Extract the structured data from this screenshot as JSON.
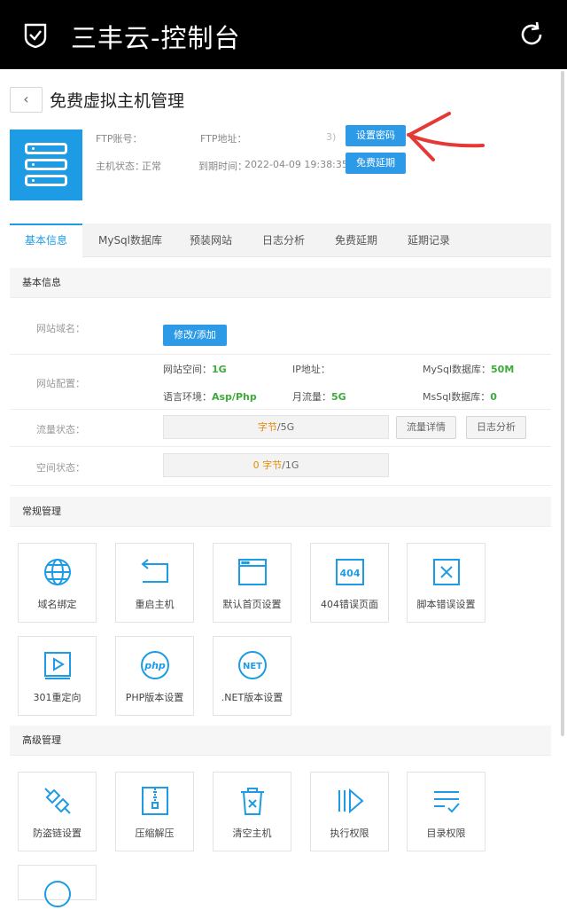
{
  "app_title": "三丰云-控制台",
  "page_title": "免费虚拟主机管理",
  "back_label": "‹",
  "host_info": {
    "ftp_account_label": "FTP账号：",
    "ftp_address_label": "FTP地址：",
    "host_status_label": "主机状态：",
    "host_status_value": "正常",
    "expire_label": "到期时间：",
    "expire_value": "2022-04-09 19:38:35",
    "bracket_fragment": "3)"
  },
  "buttons": {
    "set_password": "设置密码",
    "free_extend": "免费延期",
    "modify_add": "修改/添加",
    "traffic_detail": "流量详情",
    "log_analysis": "日志分析"
  },
  "tabs": [
    "基本信息",
    "MySql数据库",
    "预装网站",
    "日志分析",
    "免费延期",
    "延期记录"
  ],
  "basic_info": {
    "heading": "基本信息",
    "domain_label": "网站域名：",
    "config_label": "网站配置：",
    "traffic_label": "流量状态：",
    "space_label": "空间状态：",
    "site_space_label": "网站空间：",
    "site_space_value": "1G",
    "ip_label": "IP地址：",
    "mysql_label": "MySql数据库：",
    "mysql_value": "50M",
    "lang_label": "语言环境：",
    "lang_value": "Asp/Php",
    "monthly_label": "月流量：",
    "monthly_value": "5G",
    "mssql_label": "MsSql数据库：",
    "mssql_value": "0",
    "traffic_used": "字节",
    "traffic_total": "/5G",
    "space_used": "0 字节",
    "space_total": "/1G"
  },
  "regular": {
    "heading": "常规管理",
    "items": [
      {
        "label": "域名绑定",
        "icon": "globe-icon"
      },
      {
        "label": "重启主机",
        "icon": "restart-icon"
      },
      {
        "label": "默认首页设置",
        "icon": "browser-window-icon"
      },
      {
        "label": "404错误页面",
        "icon": "404-icon"
      },
      {
        "label": "脚本错误设置",
        "icon": "x-box-icon"
      },
      {
        "label": "301重定向",
        "icon": "play-box-icon"
      },
      {
        "label": "PHP版本设置",
        "icon": "php-icon"
      },
      {
        "label": ".NET版本设置",
        "icon": "net-icon"
      }
    ]
  },
  "advanced": {
    "heading": "高级管理",
    "items": [
      {
        "label": "防盗链设置",
        "icon": "broken-link-icon"
      },
      {
        "label": "压缩解压",
        "icon": "zip-icon"
      },
      {
        "label": "清空主机",
        "icon": "trash-icon"
      },
      {
        "label": "执行权限",
        "icon": "execute-icon"
      },
      {
        "label": "目录权限",
        "icon": "list-check-icon"
      }
    ]
  },
  "colors": {
    "accent": "#1e9be5",
    "button": "#2d9ae8",
    "green": "#3cab39",
    "orange": "#e48c00",
    "annotation": "#e53935"
  }
}
